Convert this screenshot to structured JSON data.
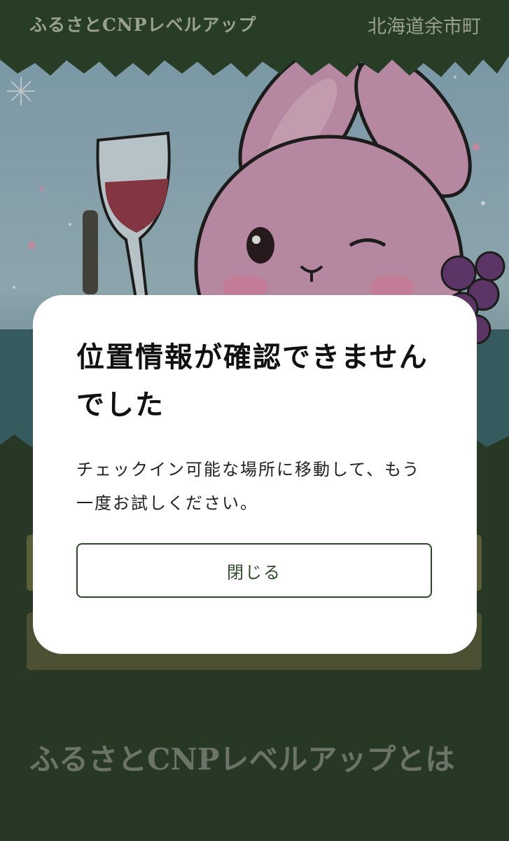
{
  "header": {
    "title": "ふるさとCNPレベルアップ",
    "location": "北海道余市町"
  },
  "modal": {
    "title": "位置情報が確認できませんでした",
    "message": "チェックイン可能な場所に移動して、もう一度お試しください。",
    "close_label": "閉じる"
  },
  "section": {
    "title": "ふるさとCNPレベルアップとは"
  },
  "colors": {
    "header_bg": "#2d452a",
    "page_bg": "#2b4029",
    "button_border": "#2c4a27",
    "lower_button": "#6b6e43"
  }
}
